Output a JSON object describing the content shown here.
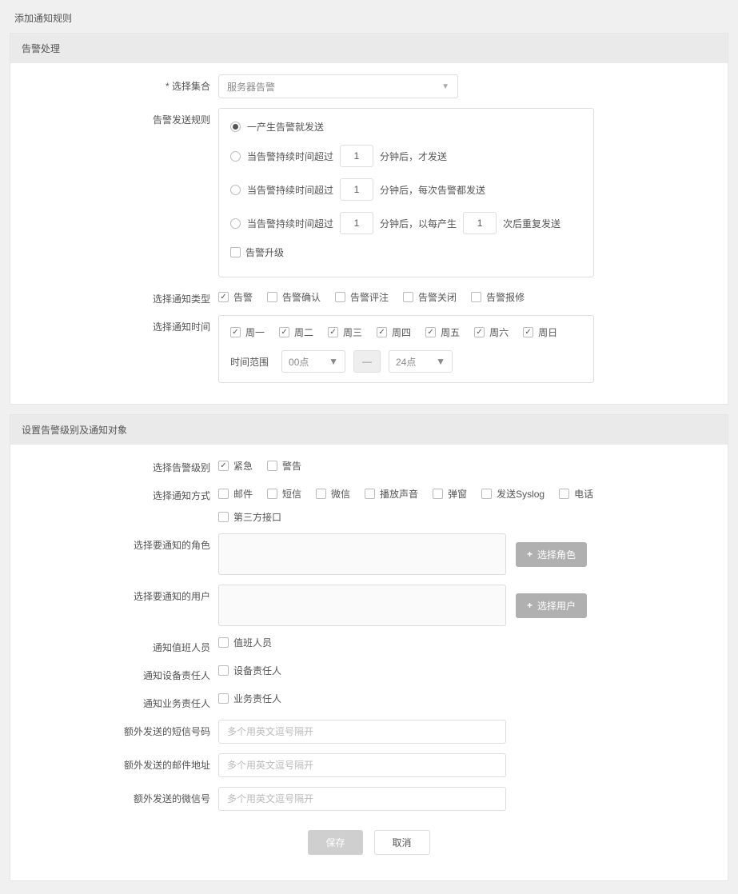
{
  "page": {
    "title": "添加通知规则"
  },
  "section1": {
    "header": "告警处理",
    "select_set": {
      "label": "* 选择集合",
      "value": "服务器告警"
    },
    "send_rules": {
      "label": "告警发送规则",
      "opt1": "一产生告警就发送",
      "opt2_pre": "当告警持续时间超过",
      "opt2_val": "1",
      "opt2_post": "分钟后，才发送",
      "opt3_pre": "当告警持续时间超过",
      "opt3_val": "1",
      "opt3_post": "分钟后，每次告警都发送",
      "opt4_pre": "当告警持续时间超过",
      "opt4_val1": "1",
      "opt4_mid": "分钟后，以每产生",
      "opt4_val2": "1",
      "opt4_post": "次后重复发送",
      "upgrade": "告警升级"
    },
    "notify_type": {
      "label": "选择通知类型",
      "items": [
        "告警",
        "告警确认",
        "告警评注",
        "告警关闭",
        "告警报修"
      ],
      "checked": [
        true,
        false,
        false,
        false,
        false
      ]
    },
    "notify_time": {
      "label": "选择通知时间",
      "days": [
        "周一",
        "周二",
        "周三",
        "周四",
        "周五",
        "周六",
        "周日"
      ],
      "range_label": "时间范围",
      "from": "00点",
      "to": "24点"
    }
  },
  "section2": {
    "header": "设置告警级别及通知对象",
    "level": {
      "label": "选择告警级别",
      "items": [
        "紧急",
        "警告"
      ],
      "checked": [
        true,
        false
      ]
    },
    "method": {
      "label": "选择通知方式",
      "row1": [
        "邮件",
        "短信",
        "微信",
        "播放声音",
        "弹窗",
        "发送Syslog",
        "电话"
      ],
      "row2": [
        "第三方接口"
      ]
    },
    "role": {
      "label": "选择要通知的角色",
      "btn": "选择角色"
    },
    "user": {
      "label": "选择要通知的用户",
      "btn": "选择用户"
    },
    "duty": {
      "label": "通知值班人员",
      "item": "值班人员"
    },
    "device": {
      "label": "通知设备责任人",
      "item": "设备责任人"
    },
    "biz": {
      "label": "通知业务责任人",
      "item": "业务责任人"
    },
    "extra_sms": {
      "label": "额外发送的短信号码",
      "placeholder": "多个用英文逗号隔开"
    },
    "extra_mail": {
      "label": "额外发送的邮件地址",
      "placeholder": "多个用英文逗号隔开"
    },
    "extra_wechat": {
      "label": "额外发送的微信号",
      "placeholder": "多个用英文逗号隔开"
    }
  },
  "footer": {
    "save": "保存",
    "cancel": "取消"
  }
}
